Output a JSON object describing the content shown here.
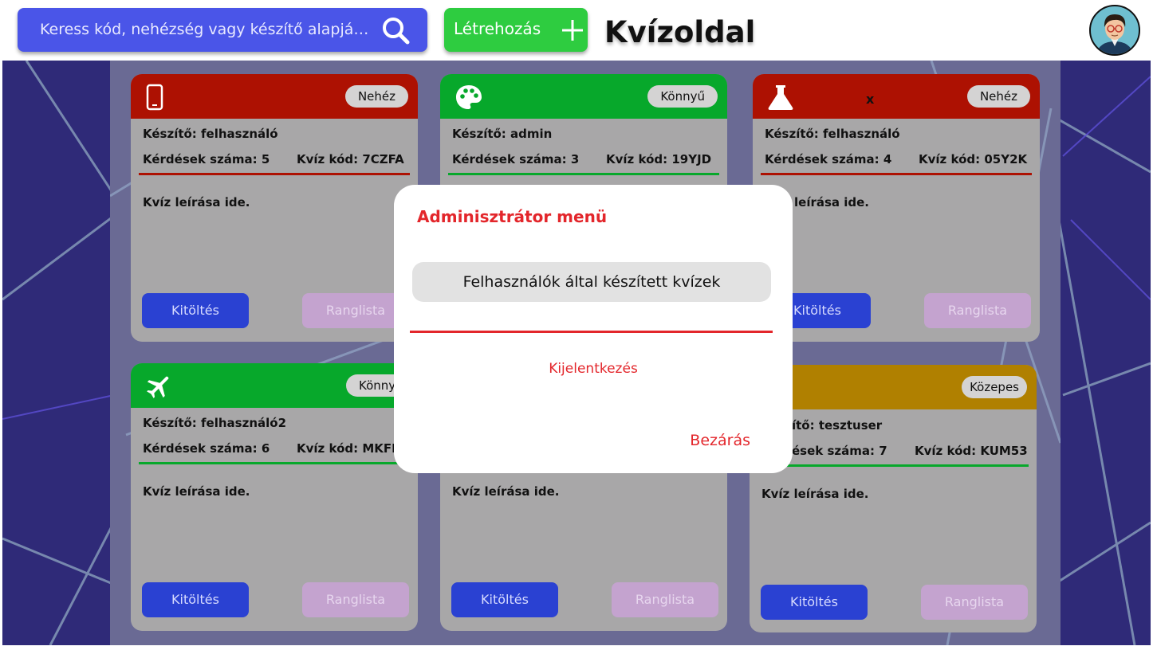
{
  "header": {
    "search_placeholder": "Keress kód, nehézség vagy készítő alapján...",
    "create_label": "Létrehozás",
    "brand": "Kvízoldal"
  },
  "colors": {
    "hard": "#ad1102",
    "easy": "#07a82b",
    "medium": "#b08000",
    "accent_red": "#e3262b",
    "button_blue": "#2a41d2"
  },
  "cards": [
    {
      "icon": "phone-icon",
      "difficulty": "Nehéz",
      "title": "",
      "creator": "Készítő: felhasználó",
      "questions": "Kérdések száma: 5",
      "code": "Kvíz kód: 7CZFA",
      "description": "Kvíz leírása ide.",
      "fill_label": "Kitöltés",
      "rank_label": "Ranglista"
    },
    {
      "icon": "palette-icon",
      "difficulty": "Könnyű",
      "title": "",
      "creator": "Készítő: admin",
      "questions": "Kérdések száma: 3",
      "code": "Kvíz kód: 19YJD",
      "description": "",
      "fill_label": "",
      "rank_label": ""
    },
    {
      "icon": "flask-icon",
      "difficulty": "Nehéz",
      "title": "x",
      "creator": "Készítő: felhasználó",
      "questions": "Kérdések száma: 4",
      "code": "Kvíz kód: 05Y2K",
      "description": "leírása ide.",
      "fill_label": "Kitöltés",
      "rank_label": "Ranglista"
    },
    {
      "icon": "airplane-icon",
      "difficulty": "Könny",
      "title": "",
      "creator": "Készítő: felhasználó2",
      "questions": "Kérdések száma: 6",
      "code": "Kvíz kód: MKFK",
      "description": "Kvíz leírása ide.",
      "fill_label": "Kitöltés",
      "rank_label": "Ranglista"
    },
    {
      "icon": "",
      "difficulty": "",
      "title": "",
      "creator": "",
      "questions": "",
      "code": "",
      "description": "Kvíz leírása ide.",
      "fill_label": "Kitöltés",
      "rank_label": "Ranglista"
    },
    {
      "icon": "",
      "difficulty": "Közepes",
      "title": "",
      "creator": "ítő: tesztuser",
      "questions": "ések száma: 7",
      "code": "Kvíz kód: KUM53",
      "description": "Kvíz leírása ide.",
      "fill_label": "Kitöltés",
      "rank_label": "Ranglista"
    }
  ],
  "modal": {
    "title": "Adminisztrátor menü",
    "item": "Felhasználók által készített kvízek",
    "logout": "Kijelentkezés",
    "close": "Bezárás"
  }
}
